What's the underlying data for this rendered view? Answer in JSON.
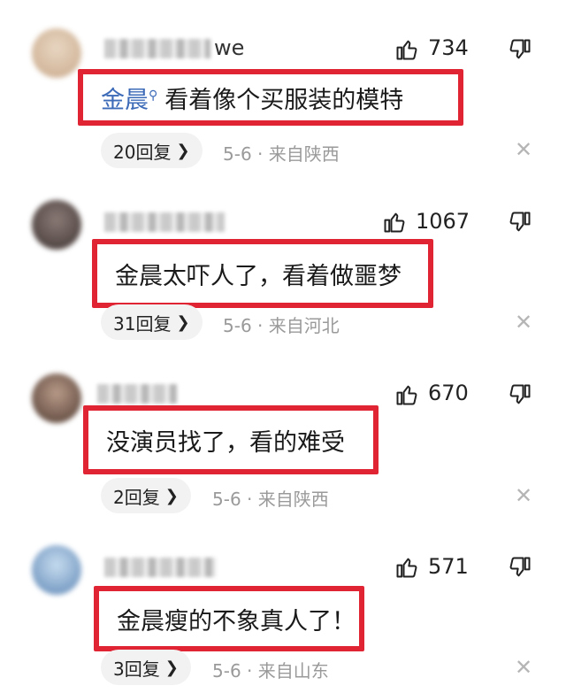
{
  "comments": [
    {
      "username_visible": "we",
      "likes": "734",
      "linked_name": "金晨",
      "text": "看着像个买服装的模特",
      "replies": "20回复",
      "date": "5-6",
      "location": "来自陕西",
      "avatar_color": "#d9c3a8"
    },
    {
      "likes": "1067",
      "text": "金晨太吓人了，看着做噩梦",
      "replies": "31回复",
      "date": "5-6",
      "location": "来自河北",
      "avatar_color": "#6b5a55"
    },
    {
      "likes": "670",
      "text": "没演员找了，看的难受",
      "replies": "2回复",
      "date": "5-6",
      "location": "来自陕西",
      "avatar_color": "#7a5f52"
    },
    {
      "likes": "571",
      "text": "金晨瘦的不象真人了！",
      "replies": "3回复",
      "date": "5-6",
      "location": "来自山东",
      "avatar_color": "#8fb0d0"
    }
  ],
  "icons": {
    "like": "thumbs-up-outline",
    "dislike": "thumbs-down-outline",
    "close": "close-x",
    "search": "search-magnifier",
    "chevron": "chevron-right"
  },
  "colors": {
    "highlight_box": "#e02433",
    "name_link": "#3d6bb8",
    "meta_text": "#9a9a9a"
  }
}
